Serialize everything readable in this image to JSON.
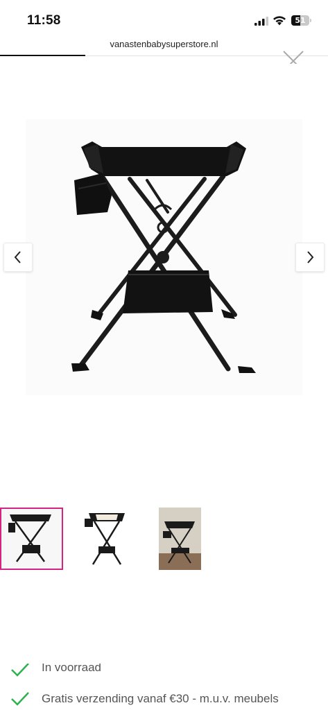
{
  "status_bar": {
    "time": "11:58",
    "battery_level": "51",
    "battery_fraction": 0.51,
    "icons": [
      "cellular-signal-icon",
      "wifi-icon",
      "battery-icon"
    ]
  },
  "browser": {
    "url": "vanastenbabysuperstore.nl",
    "load_progress_fraction": 0.26,
    "close_icon": "close-icon"
  },
  "gallery": {
    "main_image": "foldable changing table with storage basket",
    "prev_icon": "chevron-left-icon",
    "next_icon": "chevron-right-icon",
    "thumbnails": [
      {
        "selected": true
      },
      {
        "selected": false
      },
      {
        "selected": false
      }
    ],
    "selected_color": "#d3257f"
  },
  "usps": [
    {
      "text": "In voorraad",
      "icon": "checkmark-icon"
    },
    {
      "text": "Gratis verzending vanaf €30 - m.u.v. meubels",
      "icon": "checkmark-icon"
    }
  ],
  "colors": {
    "check_green": "#2bb24c",
    "accent_pink": "#d3257f"
  }
}
